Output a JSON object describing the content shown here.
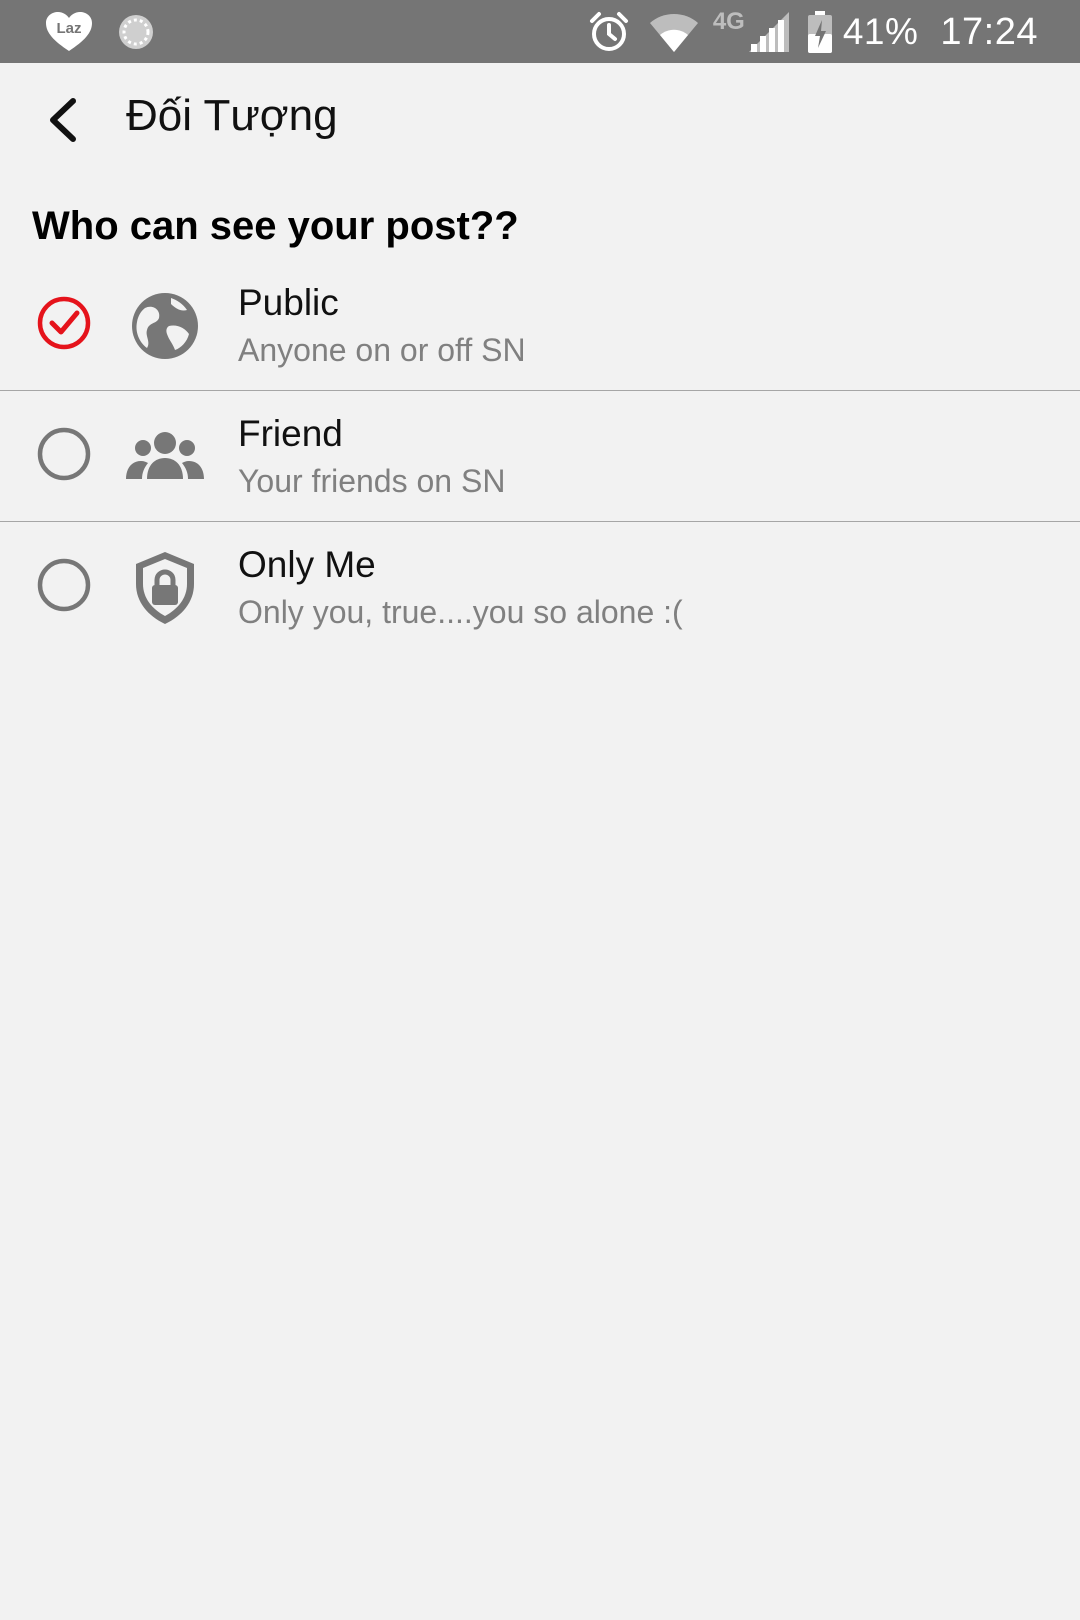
{
  "status_bar": {
    "icons": [
      "laz-icon",
      "spinner-icon",
      "alarm-icon",
      "wifi-icon",
      "signal-icon",
      "battery-icon"
    ],
    "network_type": "4G",
    "battery_percent": "41%",
    "time": "17:24"
  },
  "app_bar": {
    "back_icon": "arrow-back-icon",
    "title": "Đối Tượng"
  },
  "audience": {
    "heading": "Who can see your post??",
    "options": [
      {
        "title": "Public",
        "subtitle": "Anyone on or off SN",
        "icon": "globe-icon",
        "selected": true
      },
      {
        "title": "Friend",
        "subtitle": "Your friends on SN",
        "icon": "friends-icon",
        "selected": false
      },
      {
        "title": "Only Me",
        "subtitle": "Only you, true....you so alone :(",
        "icon": "shield-lock-icon",
        "selected": false
      }
    ]
  },
  "colors": {
    "status_bar": "#757575",
    "background": "#f2f2f2",
    "selected_accent": "#e5131b",
    "icon_gray": "#777777",
    "divider": "#a6a6a6"
  }
}
